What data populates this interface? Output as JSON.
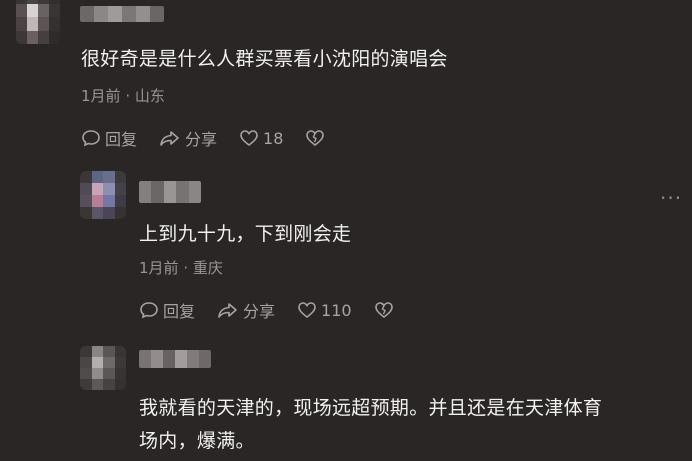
{
  "comments": [
    {
      "text": "很好奇是是什么人群买票看小沈阳的演唱会",
      "time": "1月前",
      "sep": "·",
      "location": "山东",
      "reply_label": "回复",
      "share_label": "分享",
      "likes": "18"
    },
    {
      "text": "上到九十九，下到刚会走",
      "time": "1月前",
      "sep": "·",
      "location": "重庆",
      "reply_label": "回复",
      "share_label": "分享",
      "likes": "110",
      "more_label": "···"
    },
    {
      "text_line1": "我就看的天津的，现场远超预期。并且还是在天津体育",
      "text_line2": "场内，爆满。"
    }
  ],
  "icons": {
    "reply": "reply-bubble-icon",
    "share": "share-arrow-icon",
    "like": "heart-icon",
    "dislike": "broken-heart-icon"
  },
  "colors": {
    "background": "#2b2626",
    "text": "#f2f0f0",
    "meta": "#9a9494"
  }
}
